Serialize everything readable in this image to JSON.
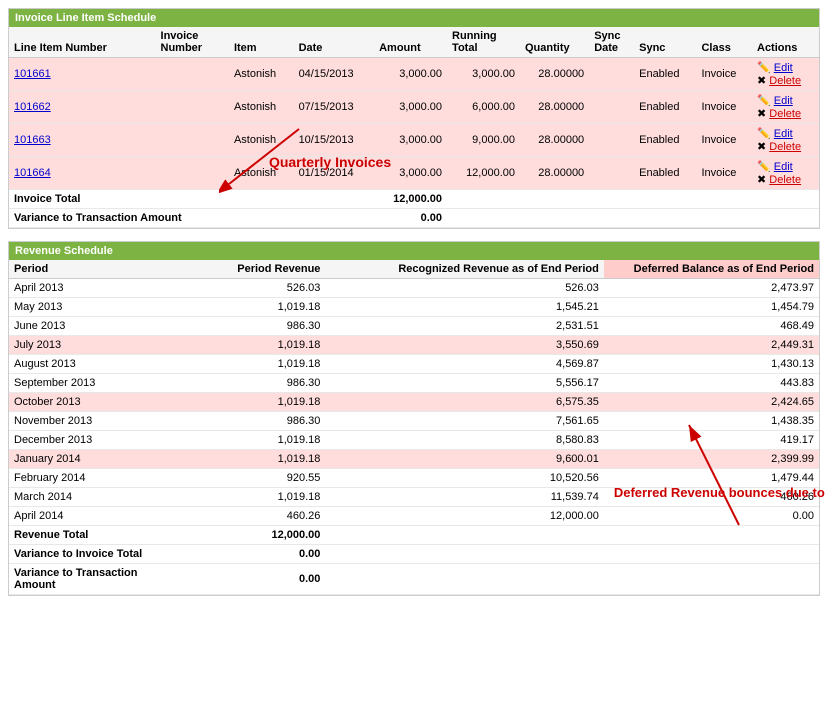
{
  "invoiceSection": {
    "title": "Invoice Line Item Schedule",
    "columns": [
      "Line Item Number",
      "Invoice Number",
      "Item",
      "Date",
      "Amount",
      "Running Total",
      "Quantity",
      "Sync Date",
      "Sync",
      "Class",
      "Actions"
    ],
    "rows": [
      {
        "lineItem": "101661",
        "invoiceNumber": "",
        "item": "Astonish",
        "date": "04/15/2013",
        "amount": "3,000.00",
        "runningTotal": "3,000.00",
        "quantity": "28.00000",
        "syncDate": "",
        "sync": "Enabled",
        "class": "Invoice",
        "pink": true
      },
      {
        "lineItem": "101662",
        "invoiceNumber": "",
        "item": "Astonish",
        "date": "07/15/2013",
        "amount": "3,000.00",
        "runningTotal": "6,000.00",
        "quantity": "28.00000",
        "syncDate": "",
        "sync": "Enabled",
        "class": "Invoice",
        "pink": true
      },
      {
        "lineItem": "101663",
        "invoiceNumber": "",
        "item": "Astonish",
        "date": "10/15/2013",
        "amount": "3,000.00",
        "runningTotal": "9,000.00",
        "quantity": "28.00000",
        "syncDate": "",
        "sync": "Enabled",
        "class": "Invoice",
        "pink": true
      },
      {
        "lineItem": "101664",
        "invoiceNumber": "",
        "item": "Astonish",
        "date": "01/15/2014",
        "amount": "3,000.00",
        "runningTotal": "12,000.00",
        "quantity": "28.00000",
        "syncDate": "",
        "sync": "Enabled",
        "class": "Invoice",
        "pink": true
      }
    ],
    "invoiceTotal": {
      "label": "Invoice Total",
      "amount": "12,000.00"
    },
    "variance": {
      "label": "Variance to Transaction Amount",
      "amount": "0.00"
    },
    "annotation": "Quarterly Invoices"
  },
  "revenueSection": {
    "title": "Revenue Schedule",
    "columns": [
      "Period",
      "Period Revenue",
      "Recognized Revenue as of End Period",
      "Deferred Balance as of End Period"
    ],
    "rows": [
      {
        "period": "April 2013",
        "periodRevenue": "526.03",
        "recognizedRevenue": "526.03",
        "deferredBalance": "2,473.97",
        "highlight": false
      },
      {
        "period": "May 2013",
        "periodRevenue": "1,019.18",
        "recognizedRevenue": "1,545.21",
        "deferredBalance": "1,454.79",
        "highlight": false
      },
      {
        "period": "June 2013",
        "periodRevenue": "986.30",
        "recognizedRevenue": "2,531.51",
        "deferredBalance": "468.49",
        "highlight": false
      },
      {
        "period": "July 2013",
        "periodRevenue": "1,019.18",
        "recognizedRevenue": "3,550.69",
        "deferredBalance": "2,449.31",
        "highlight": true
      },
      {
        "period": "August 2013",
        "periodRevenue": "1,019.18",
        "recognizedRevenue": "4,569.87",
        "deferredBalance": "1,430.13",
        "highlight": false
      },
      {
        "period": "September 2013",
        "periodRevenue": "986.30",
        "recognizedRevenue": "5,556.17",
        "deferredBalance": "443.83",
        "highlight": false
      },
      {
        "period": "October 2013",
        "periodRevenue": "1,019.18",
        "recognizedRevenue": "6,575.35",
        "deferredBalance": "2,424.65",
        "highlight": true
      },
      {
        "period": "November 2013",
        "periodRevenue": "986.30",
        "recognizedRevenue": "7,561.65",
        "deferredBalance": "1,438.35",
        "highlight": false
      },
      {
        "period": "December 2013",
        "periodRevenue": "1,019.18",
        "recognizedRevenue": "8,580.83",
        "deferredBalance": "419.17",
        "highlight": false
      },
      {
        "period": "January 2014",
        "periodRevenue": "1,019.18",
        "recognizedRevenue": "9,600.01",
        "deferredBalance": "2,399.99",
        "highlight": true
      },
      {
        "period": "February 2014",
        "periodRevenue": "920.55",
        "recognizedRevenue": "10,520.56",
        "deferredBalance": "1,479.44",
        "highlight": false
      },
      {
        "period": "March 2014",
        "periodRevenue": "1,019.18",
        "recognizedRevenue": "11,539.74",
        "deferredBalance": "460.26",
        "highlight": false
      },
      {
        "period": "April 2014",
        "periodRevenue": "460.26",
        "recognizedRevenue": "12,000.00",
        "deferredBalance": "0.00",
        "highlight": false
      }
    ],
    "revenueTotal": {
      "label": "Revenue Total",
      "amount": "12,000.00"
    },
    "varianceToInvoice": {
      "label": "Variance to Invoice Total",
      "amount": "0.00"
    },
    "varianceToTransaction": {
      "label": "Variance to Transaction Amount",
      "amount": "0.00"
    },
    "annotation": "Deferred Revenue bounces due to quartely invoices"
  },
  "actions": {
    "edit": "Edit",
    "delete": "Delete"
  }
}
